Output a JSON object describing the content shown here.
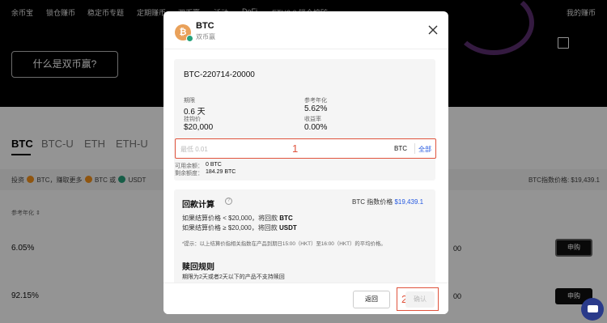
{
  "topnav": {
    "items": [
      "余币宝",
      "锁仓赚币",
      "稳定币专题",
      "定期赚币",
      "双币赢",
      "活动",
      "DeFi",
      "ETH2.0 锁仓挖矿"
    ],
    "right": "我的赚币"
  },
  "hero": {
    "button_label": "什么是双币赢?"
  },
  "tabs": [
    "BTC",
    "BTC-U",
    "ETH",
    "ETH-U"
  ],
  "info_bar": {
    "invest": "投资",
    "invest_coin": "BTC",
    "earn_more": "，赚取更多",
    "coin_a": "BTC",
    "or": "或",
    "coin_b": "USDT",
    "index_price": "BTC指数价格: $19,439.1"
  },
  "table": {
    "col_header": "参考年化 ⇕",
    "rows": [
      {
        "rate": "6.05%",
        "mid": "00",
        "action": "申购"
      },
      {
        "rate": "92.15%",
        "mid": "00",
        "action": "申购"
      }
    ]
  },
  "modal": {
    "title": "BTC",
    "subtitle": "双币赢",
    "product_id": "BTC-220714-20000",
    "term_label": "期限",
    "term_value": "0.6 天",
    "ref_rate_label": "参考年化",
    "ref_rate_value": "5.62%",
    "strike_label": "挂钩价",
    "strike_value": "$20,000",
    "yield_label": "收益率",
    "yield_value": "0.00%",
    "input_placeholder": "最低 0.01",
    "input_value": "",
    "annotation_1": "1",
    "unit": "BTC",
    "all_label": "全部",
    "available_label": "可用余额：",
    "available_value": "0 BTC",
    "remaining_label": "剩余额度：",
    "remaining_value": "184.29 BTC",
    "calc_title": "回款计算",
    "calc_index_label": "BTC 指数价格",
    "calc_index_value": "$19,439.1",
    "calc_line1_prefix": "如果结算价格 < $20,000，将回款",
    "calc_line1_coin": "BTC",
    "calc_line2_prefix": "如果结算价格 ≥ $20,000，将回款",
    "calc_line2_coin": "USDT",
    "calc_note": "*提示：以上结算价指相关指数在产品到期日15:00（HKT）至16:00（HKT）的平均价格。",
    "redeem_title": "赎回规则",
    "redeem_line": "期限为2天或者2天以下的产品不支持赎回",
    "back_label": "返回",
    "confirm_label": "确认",
    "annotation_2": "2"
  },
  "colors": {
    "accent_blue": "#2458e0",
    "annotation_red": "#e0533c",
    "btc_orange": "#f7931a",
    "usdt_green": "#26a17b"
  }
}
